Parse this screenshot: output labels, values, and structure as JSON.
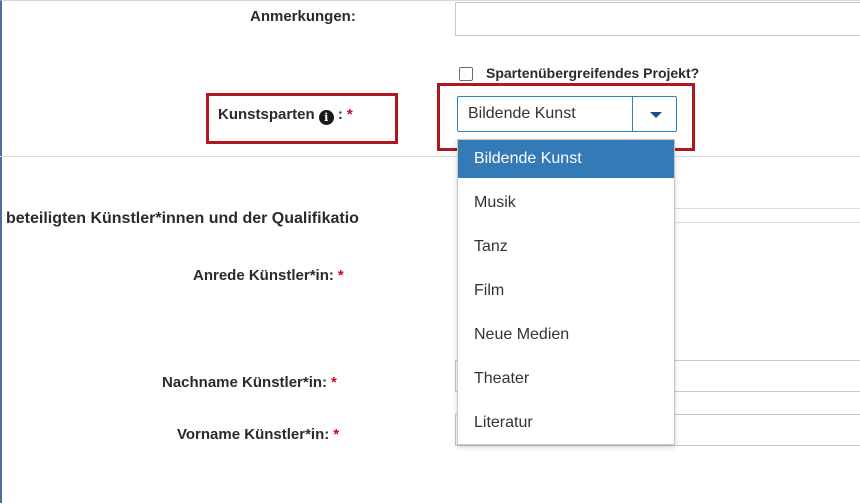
{
  "form": {
    "anmerkungen_label": "Anmerkungen:",
    "checkbox_label": "Spartenübergreifendes Projekt?",
    "kunstsparten_label": "Kunstsparten",
    "info_icon_glyph": "i",
    "colon": ":",
    "required_mark": "*",
    "section_heading": "beteiligten Künstler*innen und der Qualifikatio",
    "anrede_label": "Anrede Künstler*in:",
    "nachname_label": "Nachname Künstler*in:",
    "vorname_label": "Vorname Künstler*in:"
  },
  "select": {
    "value": "Bildende Kunst",
    "options": [
      "Bildende Kunst",
      "Musik",
      "Tanz",
      "Film",
      "Neue Medien",
      "Theater",
      "Literatur"
    ],
    "selected_index": 0
  },
  "colors": {
    "accent": "#337ab7",
    "highlight_box": "#b0181f",
    "required": "#d0021b"
  },
  "icons": {
    "info": "info-circle-icon",
    "dropdown": "chevron-down-icon"
  }
}
